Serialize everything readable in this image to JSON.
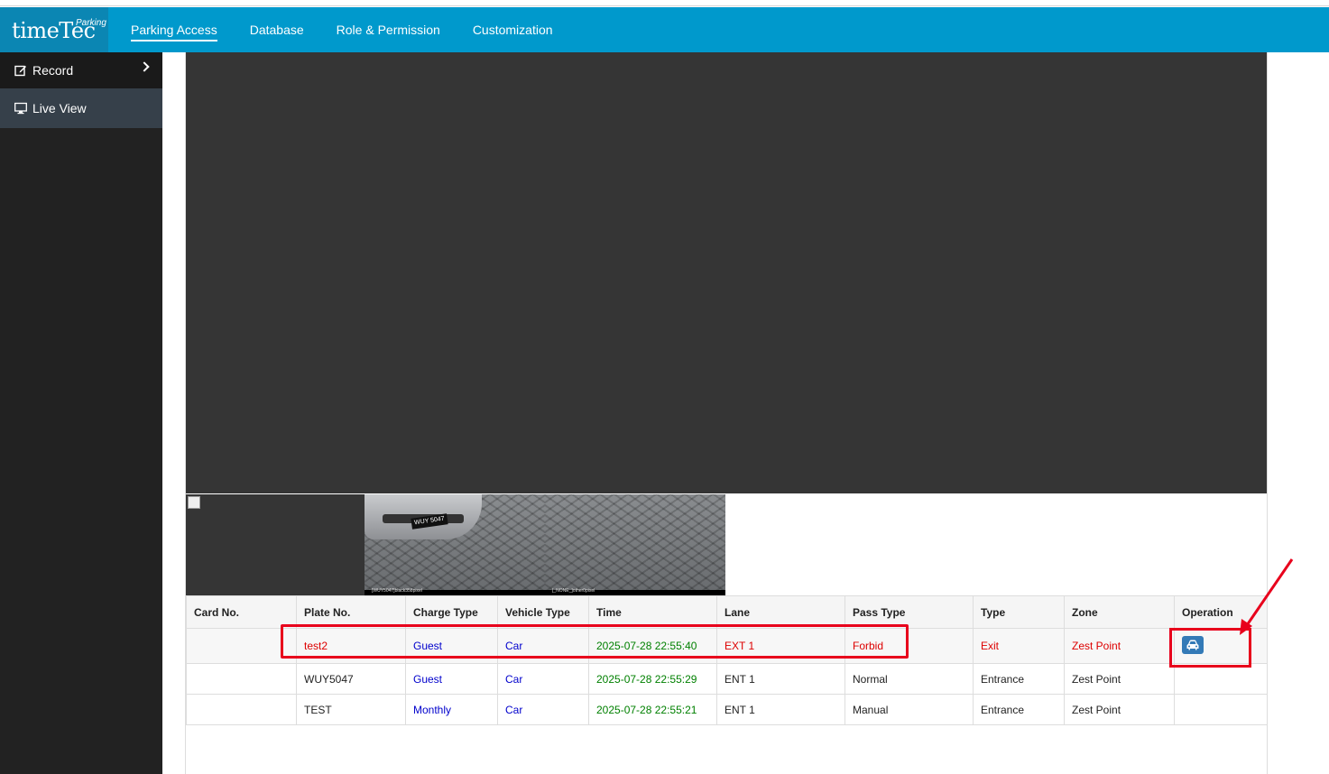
{
  "header": {
    "logo_main": "timeTec",
    "logo_sup": "Parking",
    "nav": [
      {
        "label": "Parking Access",
        "active": true
      },
      {
        "label": "Database",
        "active": false
      },
      {
        "label": "Role & Permission",
        "active": false
      },
      {
        "label": "Customization",
        "active": false
      }
    ]
  },
  "sidebar": {
    "items": [
      {
        "label": "Record",
        "icon": "edit-icon"
      },
      {
        "label": "Live View",
        "icon": "monitor-icon"
      }
    ]
  },
  "thumbnails": [
    {
      "caption": "[WUY5047]black358pixel"
    },
    {
      "caption": "[_NONE_]other0pixel"
    }
  ],
  "table": {
    "headers": [
      "Card No.",
      "Plate No.",
      "Charge Type",
      "Vehicle Type",
      "Time",
      "Lane",
      "Pass Type",
      "Type",
      "Zone",
      "Operation"
    ],
    "rows": [
      {
        "card": "",
        "plate": "test2",
        "charge": "Guest",
        "vehicle": "Car",
        "time": "2025-07-28 22:55:40",
        "lane": "EXT 1",
        "pass": "Forbid",
        "type": "Exit",
        "zone": "Zest Point"
      },
      {
        "card": "",
        "plate": "WUY5047",
        "charge": "Guest",
        "vehicle": "Car",
        "time": "2025-07-28 22:55:29",
        "lane": "ENT 1",
        "pass": "Normal",
        "type": "Entrance",
        "zone": "Zest Point"
      },
      {
        "card": "",
        "plate": "TEST",
        "charge": "Monthly",
        "vehicle": "Car",
        "time": "2025-07-28 22:55:21",
        "lane": "ENT 1",
        "pass": "Manual",
        "type": "Entrance",
        "zone": "Zest Point"
      }
    ]
  },
  "colors": {
    "header_bg": "#0099cc",
    "sidebar_bg": "#222222",
    "highlight": "#e8001c",
    "button": "#337ab7"
  }
}
